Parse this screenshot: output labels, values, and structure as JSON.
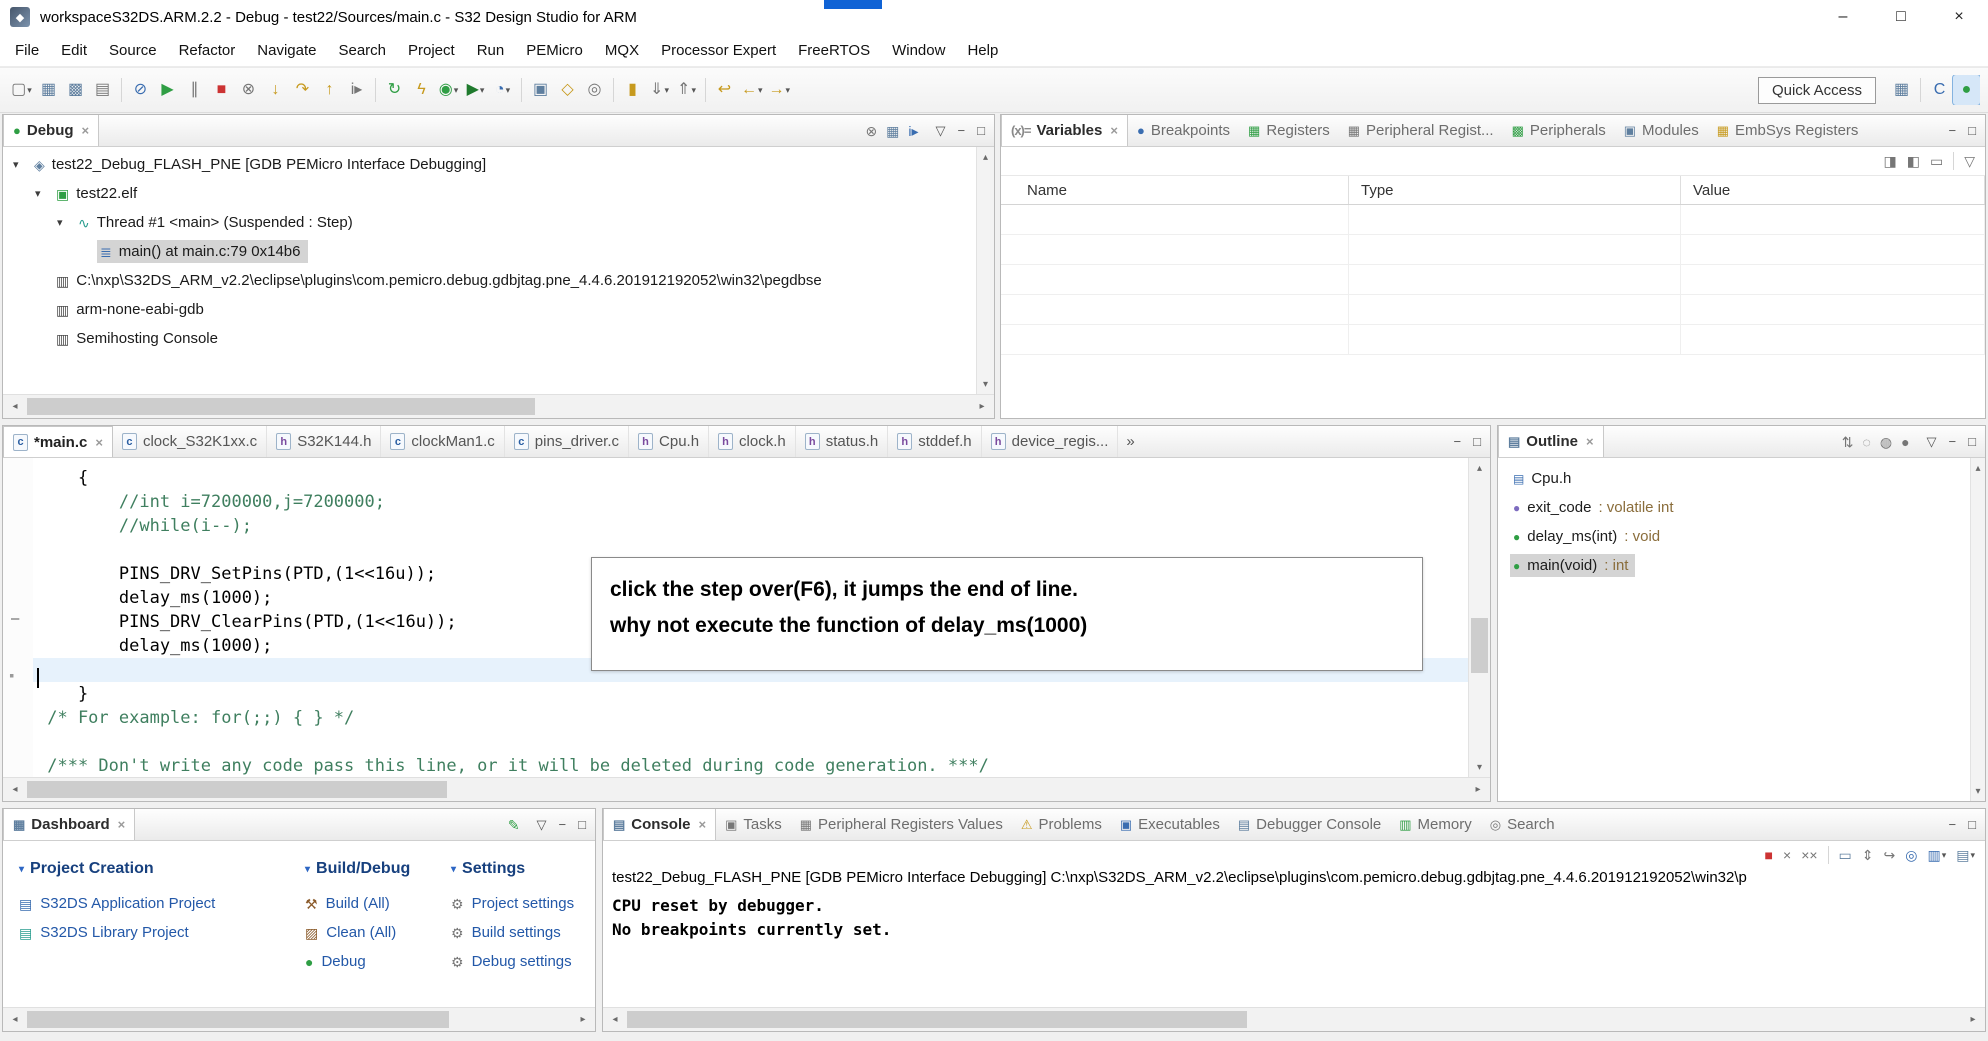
{
  "icons": {
    "left": "◂",
    "right": "▸",
    "up": "▴",
    "down": "▾",
    "app": "◆",
    "dash_marker": "–",
    "dot_marker": "▪"
  },
  "chrome": {
    "menu": "▽",
    "min": "−",
    "max": "□"
  },
  "window": {
    "title": "workspaceS32DS.ARM.2.2 - Debug - test22/Sources/main.c - S32 Design Studio for ARM",
    "controls": [
      {
        "name": "minimize-button",
        "g": "–"
      },
      {
        "name": "maximize-button",
        "g": "□"
      },
      {
        "name": "close-button",
        "g": "×"
      }
    ]
  },
  "menu": {
    "items": [
      "File",
      "Edit",
      "Source",
      "Refactor",
      "Navigate",
      "Search",
      "Project",
      "Run",
      "PEMicro",
      "MQX",
      "Processor Expert",
      "FreeRTOS",
      "Window",
      "Help"
    ]
  },
  "toolbar": {
    "quick_access": "Quick Access",
    "icons": [
      {
        "name": "new-wizard-icon",
        "g": "▢",
        "c": "g-dim",
        "dd": "▾"
      },
      {
        "name": "save-icon",
        "g": "▦",
        "c": "g-slate"
      },
      {
        "name": "save-all-icon",
        "g": "▩",
        "c": "g-slate"
      },
      {
        "name": "print-icon",
        "g": "▤",
        "c": "g-dim"
      },
      {
        "cls": "sep",
        "name": "toolbar-separator",
        "int": "false"
      },
      {
        "name": "skip-all-breakpoints-icon",
        "g": "⊘",
        "c": "g-blue"
      },
      {
        "name": "resume-icon",
        "g": "▶",
        "c": "g-green"
      },
      {
        "name": "suspend-icon",
        "g": "∥",
        "c": "g-dim"
      },
      {
        "name": "terminate-icon",
        "g": "■",
        "c": "g-red"
      },
      {
        "name": "disconnect-icon",
        "g": "⊗",
        "c": "g-dim"
      },
      {
        "name": "step-into-icon",
        "g": "↓",
        "c": "g-gold"
      },
      {
        "name": "step-over-icon",
        "g": "↷",
        "c": "g-gold"
      },
      {
        "name": "step-return-icon",
        "g": "↑",
        "c": "g-gold"
      },
      {
        "name": "instruction-stepping-icon",
        "g": "i▸",
        "c": "g-dim"
      },
      {
        "cls": "sep",
        "name": "toolbar-separator",
        "int": "false"
      },
      {
        "name": "restart-icon",
        "g": "↻",
        "c": "g-green"
      },
      {
        "name": "flash-programmer-icon",
        "g": "ϟ",
        "c": "g-gold"
      },
      {
        "name": "debug-launch-icon",
        "g": "◉",
        "c": "g-green",
        "dd": "▾"
      },
      {
        "name": "run-launch-icon",
        "g": "▶",
        "c": "g-green2",
        "dd": "▾"
      },
      {
        "name": "profile-launch-icon",
        "g": "◔",
        "c": "g-blue",
        "dd": "▾"
      },
      {
        "cls": "sep",
        "name": "toolbar-separator",
        "int": "false"
      },
      {
        "name": "new-cpp-project-icon",
        "g": "▣",
        "c": "g-slate"
      },
      {
        "name": "open-element-icon",
        "g": "◇",
        "c": "g-gold"
      },
      {
        "name": "search-icon",
        "g": "◎",
        "c": "g-dim"
      },
      {
        "cls": "sep",
        "name": "toolbar-separator",
        "int": "false"
      },
      {
        "name": "mark-occurrences-icon",
        "g": "▮",
        "c": "g-gold"
      },
      {
        "name": "next-annotation-icon",
        "g": "⇓",
        "c": "g-dim",
        "dd": "▾"
      },
      {
        "name": "previous-annotation-icon",
        "g": "⇑",
        "c": "g-dim",
        "dd": "▾"
      },
      {
        "cls": "sep",
        "name": "toolbar-separator",
        "int": "false"
      },
      {
        "name": "last-edit-location-icon",
        "g": "↩",
        "c": "g-gold"
      },
      {
        "name": "back-icon",
        "g": "←",
        "c": "g-gold",
        "dd": "▾"
      },
      {
        "name": "forward-icon",
        "g": "→",
        "c": "g-gold",
        "dd": "▾"
      }
    ],
    "right_icons": [
      {
        "name": "open-perspective-icon",
        "g": "▦",
        "c": "g-slate"
      },
      {
        "cls": "sep",
        "name": "toolbar-separator",
        "int": "false"
      },
      {
        "name": "cpp-perspective-icon",
        "g": "C",
        "c": "g-blue"
      },
      {
        "name": "debug-perspective-icon",
        "g": "●",
        "c": "g-green",
        "cls": "active"
      }
    ]
  },
  "debug": {
    "tab": {
      "label": "Debug",
      "g": "●",
      "c": "g-green",
      "close": "×"
    },
    "toolbar": [
      {
        "name": "disconnect-icon",
        "g": "⊗",
        "c": "g-dim"
      },
      {
        "name": "view-layout-icon",
        "g": "▦",
        "c": "g-slate"
      },
      {
        "name": "instruction-stepping-mode-icon",
        "g": "i▸",
        "c": "g-blue"
      }
    ],
    "tree": [
      {
        "lvl": "lvl0",
        "arrow": "▾",
        "g": "◈",
        "c": "g-slate",
        "label": "test22_Debug_FLASH_PNE [GDB PEMicro Interface Debugging]",
        "name": "tree-item-launch-config"
      },
      {
        "lvl": "lvl1",
        "arrow": "▾",
        "g": "▣",
        "c": "g-green",
        "label": "test22.elf",
        "name": "tree-item-elf"
      },
      {
        "lvl": "lvl2",
        "arrow": "▾",
        "g": "∿",
        "c": "g-teal",
        "label": "Thread #1 <main> (Suspended : Step)",
        "name": "tree-item-thread"
      },
      {
        "lvl": "lvl3",
        "arrow": "",
        "g": "≣",
        "c": "g-blue",
        "label": "main() at main.c:79 0x14b6",
        "sel": "selected",
        "name": "tree-item-stack-frame"
      },
      {
        "lvl": "lvl1",
        "arrow": "",
        "g": "▥",
        "c": "g-dark",
        "label": "C:\\nxp\\S32DS_ARM_v2.2\\eclipse\\plugins\\com.pemicro.debug.gdbjtag.pne_4.4.6.201912192052\\win32\\pegdbse",
        "name": "tree-item-pegdbserver-console"
      },
      {
        "lvl": "lvl1",
        "arrow": "",
        "g": "▥",
        "c": "g-dark",
        "label": "arm-none-eabi-gdb",
        "name": "tree-item-gdb"
      },
      {
        "lvl": "lvl1",
        "arrow": "",
        "g": "▥",
        "c": "g-dark",
        "label": "Semihosting Console",
        "name": "tree-item-semihosting-console"
      }
    ]
  },
  "variables": {
    "tabs": [
      {
        "label": "Variables",
        "g": "(x)=",
        "c": "ic-vars",
        "cls": "selected",
        "close": "×",
        "name": "tab-variables"
      },
      {
        "label": "Breakpoints",
        "g": "●",
        "c": "g-blue",
        "name": "tab-breakpoints"
      },
      {
        "label": "Registers",
        "g": "▦",
        "c": "g-green",
        "name": "tab-registers"
      },
      {
        "label": "Peripheral Regist...",
        "g": "▦",
        "c": "g-dim",
        "name": "tab-peripheral-registers"
      },
      {
        "label": "Peripherals",
        "g": "▩",
        "c": "g-green",
        "name": "tab-peripherals"
      },
      {
        "label": "Modules",
        "g": "▣",
        "c": "g-slate",
        "name": "tab-modules"
      },
      {
        "label": "EmbSys Registers",
        "g": "▦",
        "c": "g-gold",
        "name": "tab-embsys-registers"
      }
    ],
    "toolbar": [
      {
        "name": "show-type-names-icon",
        "g": "◨",
        "c": "g-dim"
      },
      {
        "name": "show-logical-structures-icon",
        "g": "◧",
        "c": "g-dim"
      },
      {
        "name": "collapse-all-icon",
        "g": "▭",
        "c": "g-dim"
      },
      {
        "cls": "sep",
        "name": "toolbar-separator",
        "int": "false"
      },
      {
        "name": "view-menu-icon",
        "g": "▽",
        "c": "g-dim"
      }
    ],
    "columns": [
      "Name",
      "Type",
      "Value"
    ]
  },
  "editor": {
    "tabs": [
      {
        "label": "*main.c",
        "ext": "c",
        "fcls": "fic-c",
        "cls": "selected",
        "close": "×",
        "name": "tab-main-c"
      },
      {
        "label": "clock_S32K1xx.c",
        "ext": "c",
        "fcls": "fic-c",
        "name": "tab-clock-s32k1xx-c"
      },
      {
        "label": "S32K144.h",
        "ext": "h",
        "fcls": "fic-h",
        "name": "tab-s32k144-h"
      },
      {
        "label": "clockMan1.c",
        "ext": "c",
        "fcls": "fic-c",
        "name": "tab-clockman1-c"
      },
      {
        "label": "pins_driver.c",
        "ext": "c",
        "fcls": "fic-c",
        "name": "tab-pins-driver-c"
      },
      {
        "label": "Cpu.h",
        "ext": "h",
        "fcls": "fic-h",
        "name": "tab-cpu-h"
      },
      {
        "label": "clock.h",
        "ext": "h",
        "fcls": "fic-h",
        "name": "tab-clock-h"
      },
      {
        "label": "status.h",
        "ext": "h",
        "fcls": "fic-h",
        "name": "tab-status-h"
      },
      {
        "label": "stddef.h",
        "ext": "h",
        "fcls": "fic-h",
        "name": "tab-stddef-h"
      },
      {
        "label": "device_regis...",
        "ext": "h",
        "fcls": "fic-h",
        "name": "tab-device-registers-h"
      }
    ],
    "overflow": "»",
    "code": [
      {
        "text": "    {",
        "cls": "plain"
      },
      {
        "text": "        //int i=7200000,j=7200000;",
        "cls": "comment"
      },
      {
        "text": "        //while(i--);",
        "cls": "comment"
      },
      {
        "text": "",
        "cls": "plain"
      },
      {
        "text": "        PINS_DRV_SetPins(PTD,(1<<16u));",
        "cls": "plain"
      },
      {
        "text": "        delay_ms(1000);",
        "cls": "plain"
      },
      {
        "text": "        PINS_DRV_ClearPins(PTD,(1<<16u));",
        "cls": "plain"
      },
      {
        "text": "        delay_ms(1000);",
        "cls": "plain"
      },
      {
        "text": "",
        "cls": "current"
      },
      {
        "text": "    }",
        "cls": "plain"
      },
      {
        "text": " /* For example: for(;;) { } */",
        "cls": "comment"
      },
      {
        "text": "",
        "cls": "plain"
      },
      {
        "text": " /*** Don't write any code pass this line, or it will be deleted during code generation. ***/",
        "cls": "comment"
      }
    ],
    "note": {
      "line1": "click the step over(F6), it jumps the end of line.",
      "line2": "why not execute the function of delay_ms(1000)"
    }
  },
  "outline": {
    "tab": {
      "label": "Outline",
      "g": "▤",
      "c": "g-slate",
      "close": "×"
    },
    "toolbar": [
      {
        "name": "sort-icon",
        "g": "⇅",
        "c": "g-dim"
      },
      {
        "name": "hide-fields-icon",
        "g": "◌",
        "c": "g-dim"
      },
      {
        "name": "hide-static-members-icon",
        "g": "◍",
        "c": "g-dim"
      },
      {
        "name": "hide-non-public-members-icon",
        "g": "●",
        "c": "g-dim"
      }
    ],
    "items": [
      {
        "g": "▤",
        "c": "g-blue",
        "label": "Cpu.h",
        "suffix": "",
        "name": "outline-item-cpu-h"
      },
      {
        "g": "●",
        "c": "g-purple",
        "label": "exit_code",
        "suffix": " : volatile int",
        "name": "outline-item-exit-code"
      },
      {
        "g": "●",
        "c": "g-green",
        "label": "delay_ms(int)",
        "suffix": " : void",
        "name": "outline-item-delay-ms"
      },
      {
        "g": "●",
        "c": "g-green",
        "label": "main(void)",
        "suffix": " : int",
        "sel": "selected",
        "name": "outline-item-main"
      }
    ]
  },
  "dashboard": {
    "tab": {
      "label": "Dashboard",
      "g": "▦",
      "c": "g-slate",
      "close": "×"
    },
    "tri": "▾",
    "toolbar": [
      {
        "name": "edit-dashboard-icon",
        "g": "✎",
        "c": "g-green"
      }
    ],
    "columns": [
      {
        "title": "Project Creation",
        "items": [
          {
            "g": "▤",
            "c": "g-blue",
            "label": "S32DS Application Project",
            "name": "link-s32ds-application-project"
          },
          {
            "g": "▤",
            "c": "g-teal",
            "label": "S32DS Library Project",
            "name": "link-s32ds-library-project"
          }
        ]
      },
      {
        "title": "Build/Debug",
        "items": [
          {
            "g": "⚒",
            "c": "g-brown",
            "label": "Build (All)",
            "name": "link-build-all"
          },
          {
            "g": "▨",
            "c": "g-brown",
            "label": "Clean (All)",
            "name": "link-clean-all"
          },
          {
            "g": "●",
            "c": "g-green",
            "label": "Debug",
            "name": "link-debug"
          }
        ]
      },
      {
        "title": "Settings",
        "items": [
          {
            "g": "⚙",
            "c": "g-dim",
            "label": "Project settings",
            "name": "link-project-settings"
          },
          {
            "g": "⚙",
            "c": "g-dim",
            "label": "Build settings",
            "name": "link-build-settings"
          },
          {
            "g": "⚙",
            "c": "g-dim",
            "label": "Debug settings",
            "name": "link-debug-settings"
          }
        ]
      }
    ]
  },
  "console": {
    "tabs": [
      {
        "label": "Console",
        "g": "▤",
        "c": "g-slate",
        "cls": "selected",
        "close": "×",
        "name": "tab-console"
      },
      {
        "label": "Tasks",
        "g": "▣",
        "c": "g-dim",
        "name": "tab-tasks"
      },
      {
        "label": "Peripheral Registers Values",
        "g": "▦",
        "c": "g-dim",
        "name": "tab-peripheral-registers-values"
      },
      {
        "label": "Problems",
        "g": "⚠",
        "c": "g-gold",
        "name": "tab-problems"
      },
      {
        "label": "Executables",
        "g": "▣",
        "c": "g-blue",
        "name": "tab-executables"
      },
      {
        "label": "Debugger Console",
        "g": "▤",
        "c": "g-slate",
        "name": "tab-debugger-console"
      },
      {
        "label": "Memory",
        "g": "▥",
        "c": "g-green",
        "name": "tab-memory"
      },
      {
        "label": "Search",
        "g": "◎",
        "c": "g-dim",
        "name": "tab-search"
      }
    ],
    "toolbar": [
      {
        "name": "terminate-icon",
        "g": "■",
        "c": "g-red"
      },
      {
        "name": "remove-launch-icon",
        "g": "×",
        "c": "g-dim"
      },
      {
        "name": "remove-all-terminated-icon",
        "g": "××",
        "c": "g-dim"
      },
      {
        "cls": "sep",
        "name": "toolbar-separator",
        "int": "false"
      },
      {
        "name": "clear-console-icon",
        "g": "▭",
        "c": "g-slate"
      },
      {
        "name": "scroll-lock-icon",
        "g": "⇕",
        "c": "g-dim"
      },
      {
        "name": "word-wrap-icon",
        "g": "↪",
        "c": "g-dim"
      },
      {
        "name": "pin-console-icon",
        "g": "◎",
        "c": "g-blue"
      },
      {
        "name": "display-selected-console-icon",
        "g": "▥",
        "c": "g-blue",
        "dd": "▾"
      },
      {
        "name": "open-console-icon",
        "g": "▤",
        "c": "g-slate",
        "dd": "▾"
      }
    ],
    "banner": "test22_Debug_FLASH_PNE [GDB PEMicro Interface Debugging] C:\\nxp\\S32DS_ARM_v2.2\\eclipse\\plugins\\com.pemicro.debug.gdbjtag.pne_4.4.6.201912192052\\win32\\p",
    "lines": [
      "CPU reset by debugger.",
      "",
      "No breakpoints currently set."
    ]
  }
}
